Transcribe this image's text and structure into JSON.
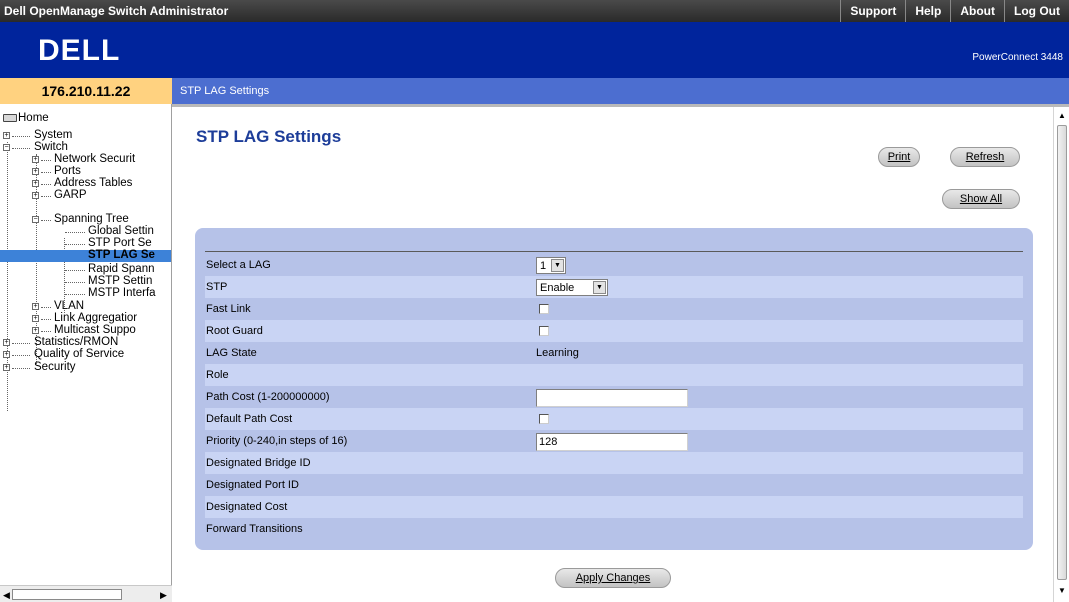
{
  "window": {
    "title": "Dell OpenManage Switch Administrator",
    "links": [
      "Support",
      "Help",
      "About",
      "Log Out"
    ]
  },
  "header": {
    "logo_text": "DELL",
    "product": "PowerConnect 3448"
  },
  "ip_address": "176.210.11.22",
  "breadcrumb": "STP LAG Settings",
  "nav": {
    "home": "Home",
    "items": [
      "System",
      "Switch",
      "Network Securit",
      "Ports",
      "Address Tables",
      "GARP",
      "Spanning Tree",
      "Global Settin",
      "STP Port Se",
      "STP LAG Se",
      "Rapid Spann",
      "MSTP Settin",
      "MSTP Interfa",
      "VLAN",
      "Link Aggregatior",
      "Multicast Suppo",
      "Statistics/RMON",
      "Quality of Service",
      "Security"
    ],
    "selected": "STP LAG Se"
  },
  "page": {
    "title": "STP LAG Settings",
    "buttons": {
      "print": "Print",
      "refresh": "Refresh",
      "show_all": "Show All",
      "apply": "Apply Changes"
    }
  },
  "form": {
    "select_lag": {
      "label": "Select a LAG",
      "value": "1"
    },
    "stp": {
      "label": "STP",
      "value": "Enable"
    },
    "fast_link": {
      "label": "Fast Link",
      "checked": false
    },
    "root_guard": {
      "label": "Root Guard",
      "checked": false
    },
    "lag_state": {
      "label": "LAG State",
      "value": "Learning"
    },
    "role": {
      "label": "Role",
      "value": ""
    },
    "path_cost": {
      "label": "Path Cost (1-200000000)",
      "value": ""
    },
    "default_path_cost": {
      "label": "Default Path Cost",
      "checked": false
    },
    "priority": {
      "label": "Priority (0-240,in steps of 16)",
      "value": "128"
    },
    "designated_bridge_id": {
      "label": "Designated Bridge ID",
      "value": ""
    },
    "designated_port_id": {
      "label": "Designated Port ID",
      "value": ""
    },
    "designated_cost": {
      "label": "Designated Cost",
      "value": ""
    },
    "forward_transitions": {
      "label": "Forward Transitions",
      "value": ""
    }
  },
  "colors": {
    "header_blue": "#00249c",
    "ip_box": "#ffd280",
    "breadcrumb_bar": "#4c6ed0",
    "panel": "#b6c2e8",
    "panel_alt_row": "#c9d4f4",
    "title_blue": "#1d3d99",
    "nav_selected": "#3d82d8"
  }
}
